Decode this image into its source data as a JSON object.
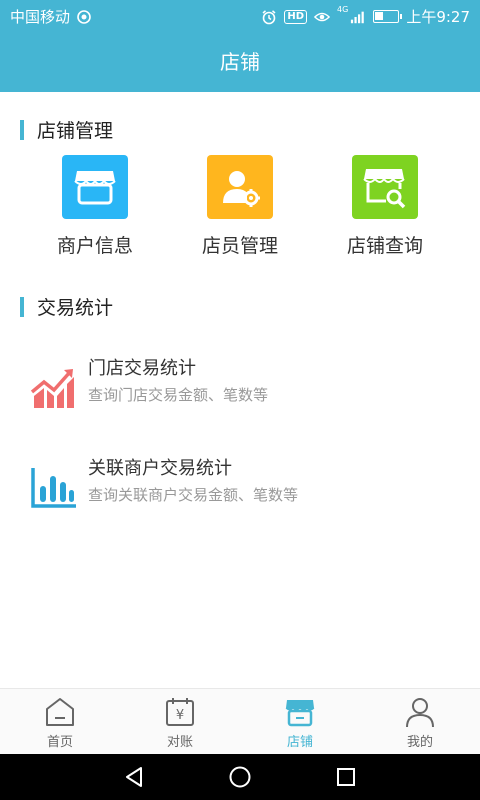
{
  "status_bar": {
    "carrier": "中国移动",
    "network_badge": "HD",
    "signal_label": "4G",
    "time": "上午9:27"
  },
  "header": {
    "title": "店铺"
  },
  "store_management": {
    "title": "店铺管理",
    "items": [
      {
        "label": "商户信息",
        "icon": "store-icon",
        "color": "#29b6f6"
      },
      {
        "label": "店员管理",
        "icon": "clerk-settings-icon",
        "color": "#ffb61e"
      },
      {
        "label": "店铺查询",
        "icon": "store-search-icon",
        "color": "#7ed321"
      }
    ]
  },
  "transaction_stats": {
    "title": "交易统计",
    "items": [
      {
        "title": "门店交易统计",
        "subtitle": "查询门店交易金额、笔数等",
        "icon": "trend-chart-icon",
        "color": "#f06e6e"
      },
      {
        "title": "关联商户交易统计",
        "subtitle": "查询关联商户交易金额、笔数等",
        "icon": "bar-chart-icon",
        "color": "#2aa3d6"
      }
    ]
  },
  "tabbar": {
    "tabs": [
      {
        "label": "首页",
        "icon": "home-icon"
      },
      {
        "label": "对账",
        "icon": "reconciliation-icon"
      },
      {
        "label": "店铺",
        "icon": "store-tab-icon",
        "active": true
      },
      {
        "label": "我的",
        "icon": "profile-icon"
      }
    ],
    "accent_color": "#45b5d3"
  }
}
